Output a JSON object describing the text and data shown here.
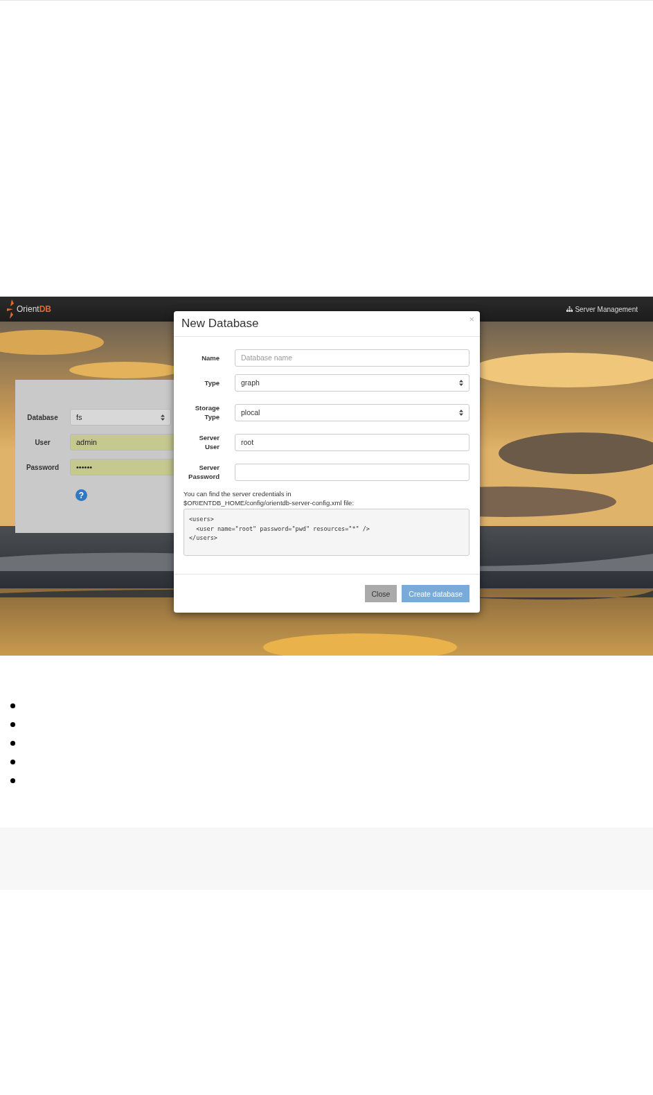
{
  "navbar": {
    "brand": "Orient",
    "brand_accent": "DB",
    "link": "Server Management"
  },
  "login": {
    "fields": [
      {
        "label": "Database",
        "value": "fs",
        "kind": "select"
      },
      {
        "label": "User",
        "value": "admin",
        "kind": "text"
      },
      {
        "label": "Password",
        "value": "••••••",
        "kind": "text"
      }
    ],
    "help": "?"
  },
  "modal": {
    "title": "New Database",
    "close": "×",
    "fields": [
      {
        "label": "Name",
        "placeholder": "Database name",
        "kind": "text"
      },
      {
        "label": "Type",
        "value": "graph",
        "kind": "select"
      },
      {
        "label": "Storage Type",
        "value": "plocal",
        "kind": "select"
      },
      {
        "label": "Server User",
        "value": "root",
        "kind": "text"
      },
      {
        "label": "Server Password",
        "kind": "text"
      }
    ],
    "hint_lines": [
      "You can find the server credentials in",
      "$ORIENTDB_HOME/config/orientdb-server-config.xml file:"
    ],
    "code": [
      "<users>",
      "  <user name=\"root\" password=\"pwd\" resources=\"*\" />",
      "</users>"
    ],
    "buttons": [
      {
        "label": "Close",
        "kind": "default"
      },
      {
        "label": "Create database",
        "kind": "primary"
      }
    ]
  },
  "bullets": [
    {
      "kind": "bullet"
    },
    {
      "kind": "bullet"
    },
    {
      "kind": "bullet"
    },
    {
      "kind": "bullet"
    },
    {
      "kind": "bullet"
    }
  ]
}
